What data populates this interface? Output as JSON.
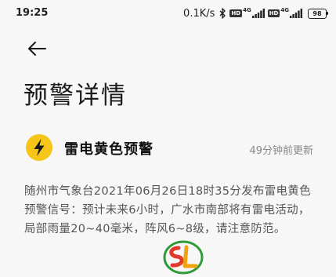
{
  "status_bar": {
    "time": "19:25",
    "net_speed": "0.1K/s",
    "sim1": {
      "hd": "HD",
      "network": "4G"
    },
    "sim2": {
      "hd": "HD",
      "network": "4G"
    },
    "battery": "98"
  },
  "nav": {
    "back_icon": "arrow-left-icon"
  },
  "page": {
    "title": "预警详情"
  },
  "alert": {
    "icon": "lightning-bolt-icon",
    "icon_color": "#f5c518",
    "title": "雷电黄色预警",
    "updated": "49分钟前更新",
    "body": "随州市气象台2021年06月26日18时35分发布雷电黄色预警信号：预计未来6小时，广水市南部将有雷电活动，局部雨量20~40毫米，阵风6~8级，请注意防范。"
  },
  "watermark_logo": "SL"
}
